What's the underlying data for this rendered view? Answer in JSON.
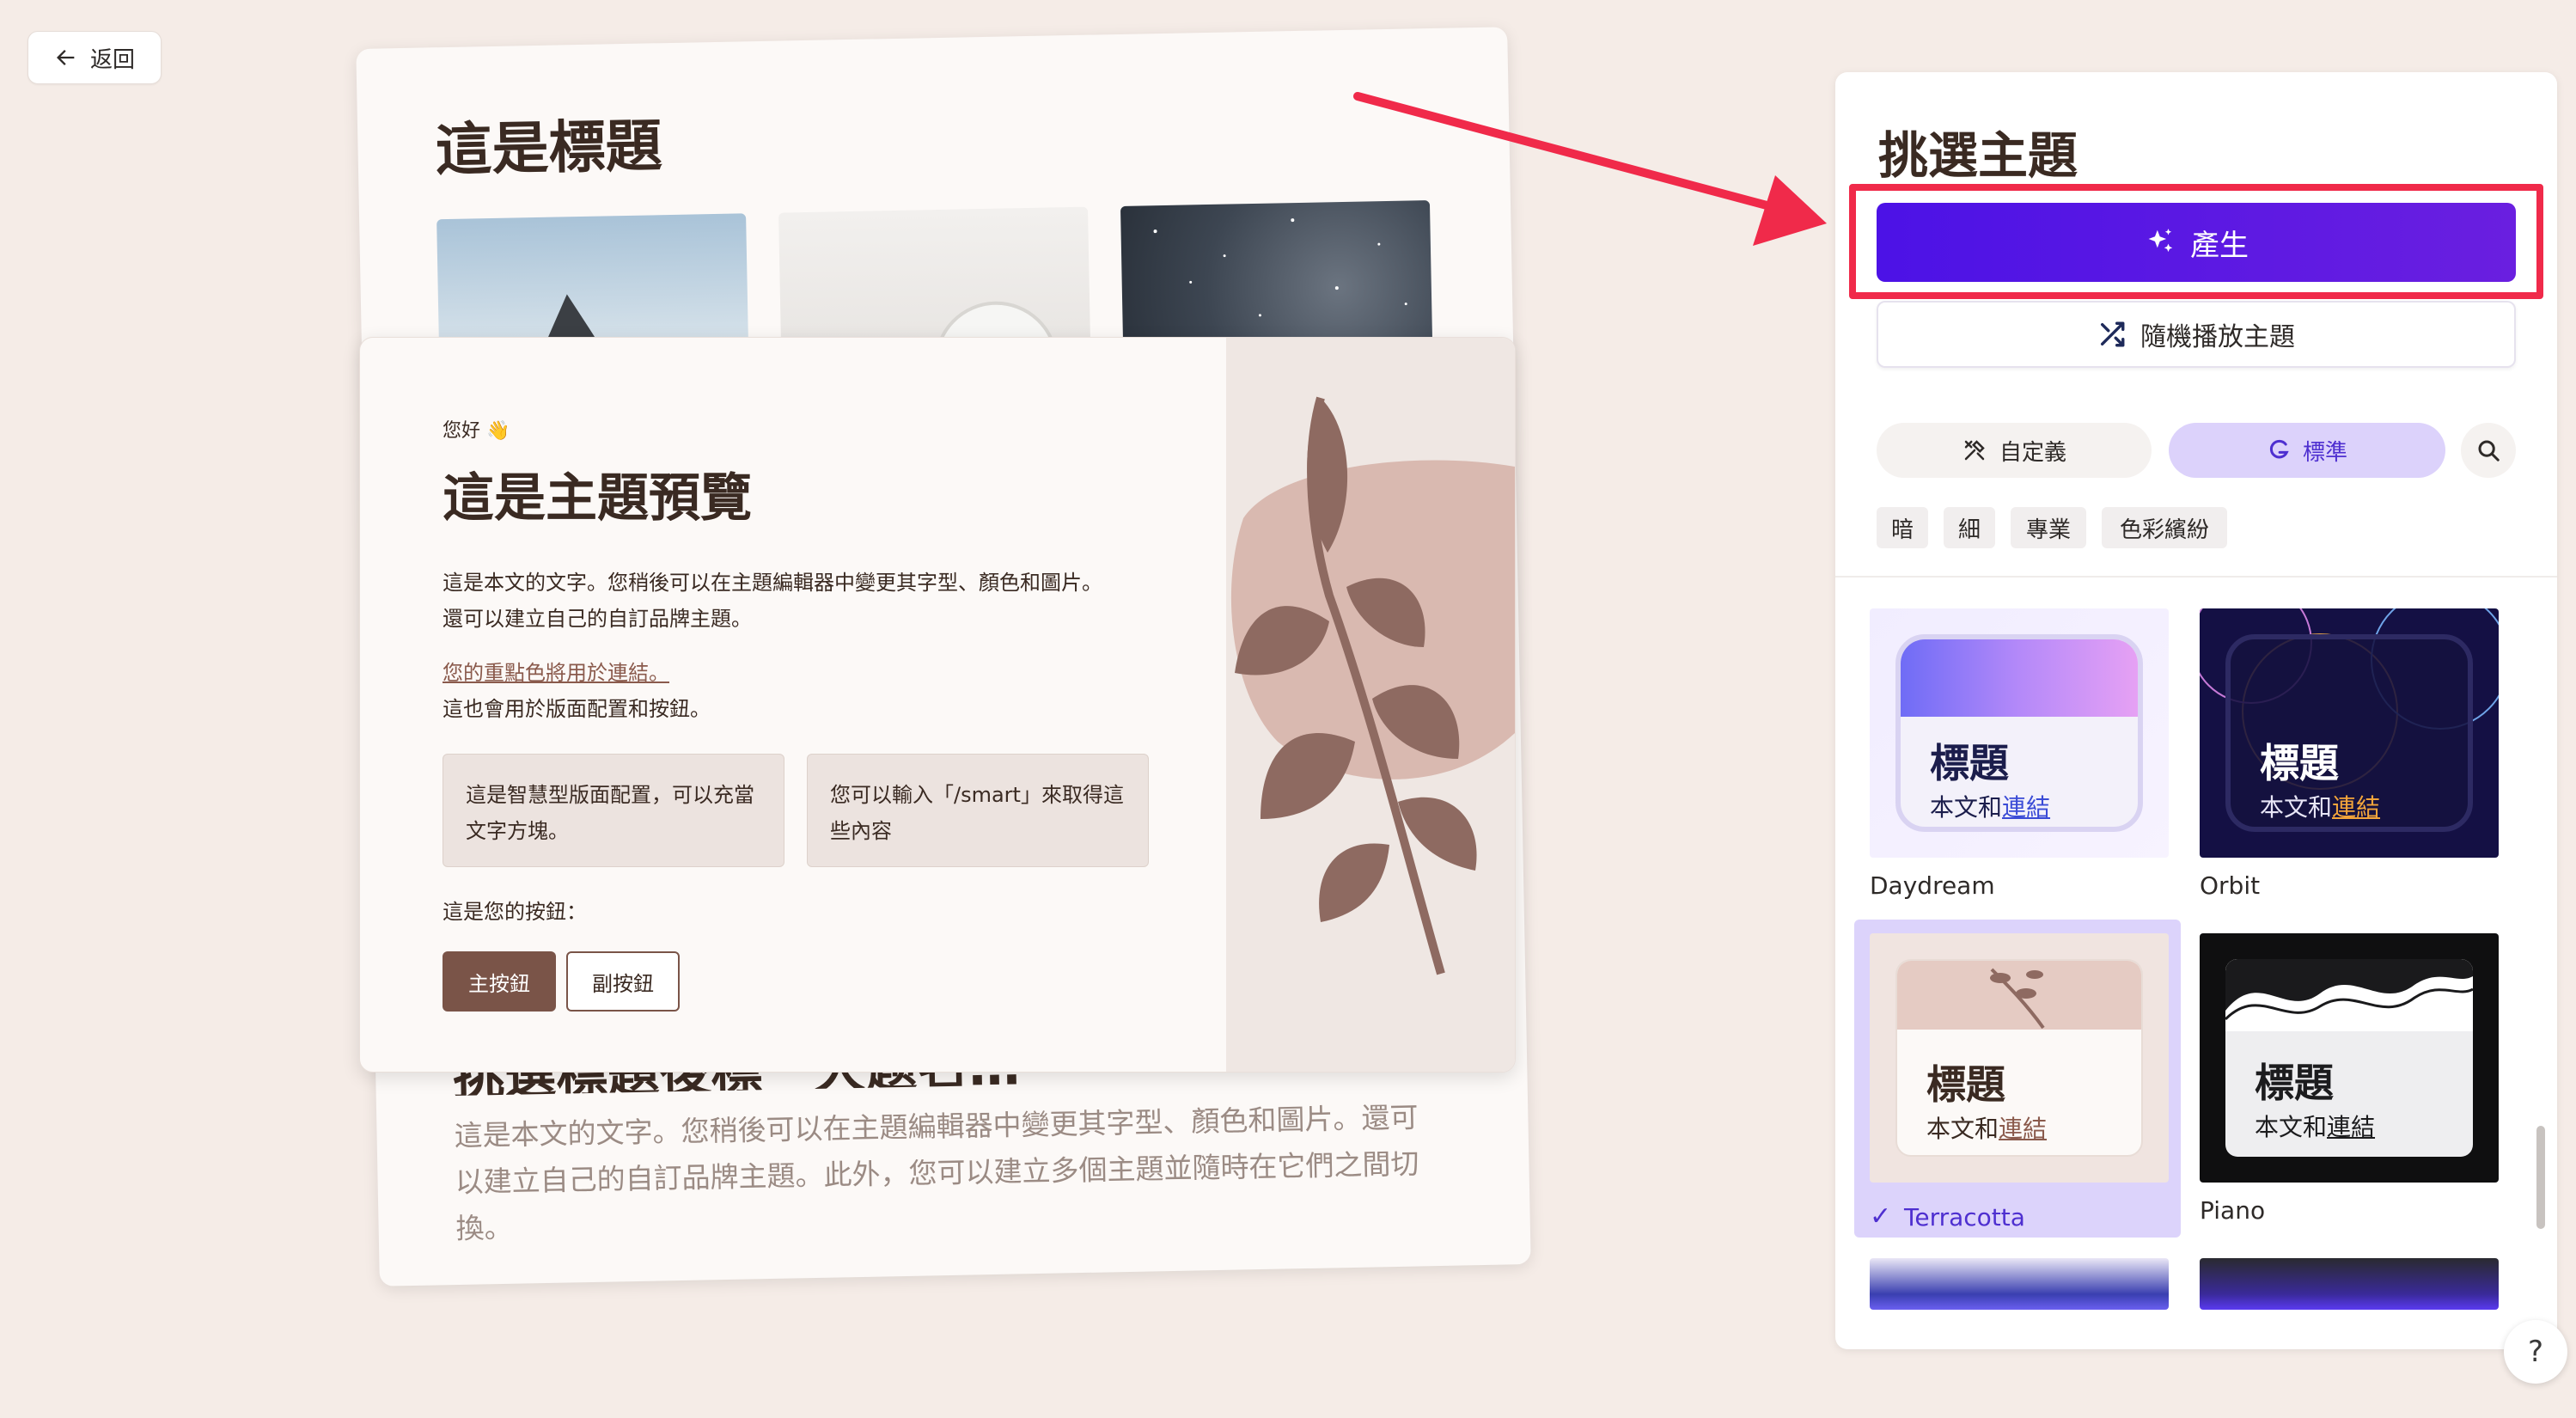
{
  "nav": {
    "back_label": "返回"
  },
  "background_card": {
    "title": "這是標題",
    "heading_partial": "挑選標題後標一大题名…",
    "body": "這是本文的文字。您稍後可以在主題編輯器中變更其字型、顏色和圖片。還可以建立自己的自訂品牌主題。此外，您可以建立多個主題並隨時在它們之間切換。"
  },
  "preview": {
    "greeting": "您好 👋",
    "title": "這是主題預覽",
    "body_line1": "這是本文的文字。您稍後可以在主題編輯器中變更其字型、顏色和圖片。",
    "body_line2": "還可以建立自己的自訂品牌主題。",
    "accent_link": "您的重點色將用於連結。",
    "layout_note": "這也會用於版面配置和按鈕。",
    "smart_box_1": "這是智慧型版面配置，可以充當文字方塊。",
    "smart_box_2": "您可以輸入「/smart」來取得這些內容",
    "buttons_label": "這是您的按鈕：",
    "primary_button": "主按鈕",
    "secondary_button": "副按鈕"
  },
  "panel": {
    "title": "挑選主題",
    "generate_label": "產生",
    "shuffle_label": "隨機播放主題",
    "tabs": {
      "custom": "自定義",
      "standard": "標準"
    },
    "filters": [
      "暗",
      "細",
      "專業",
      "色彩繽紛"
    ],
    "themes": [
      {
        "name": "Daydream",
        "card_title": "標題",
        "card_text": "本文和",
        "card_link": "連結"
      },
      {
        "name": "Orbit",
        "card_title": "標題",
        "card_text": "本文和",
        "card_link": "連結"
      },
      {
        "name": "Terracotta",
        "card_title": "標題",
        "card_text": "本文和",
        "card_link": "連結",
        "selected": true
      },
      {
        "name": "Piano",
        "card_title": "標題",
        "card_text": "本文和",
        "card_link": "連結"
      }
    ]
  },
  "help": {
    "label": "?"
  },
  "colors": {
    "generate_button": "#5a18e4",
    "highlight": "#f02a4a",
    "accent_terracotta": "#7a5448",
    "selected_theme": "#4e2fd0"
  }
}
